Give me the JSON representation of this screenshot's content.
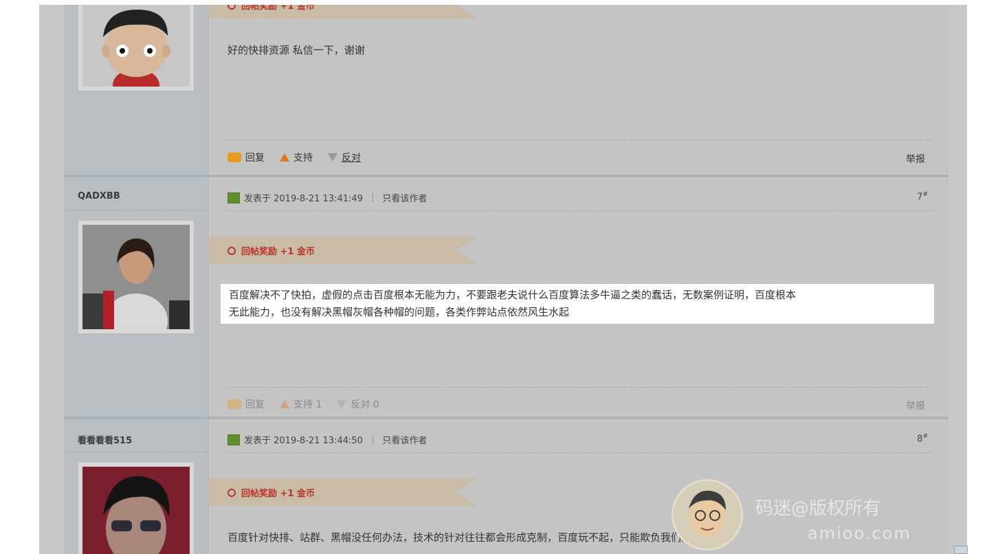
{
  "posts": [
    {
      "author": "",
      "body": "好的快排资源 私信一下，谢谢",
      "reward": "回帖奖励 +1 金币",
      "actions": {
        "reply": "回复",
        "support": "支持",
        "oppose": "反对",
        "report": "举报"
      }
    },
    {
      "author": "QADXBB",
      "meta_prefix": "发表于 2019-8-21 13:41:49",
      "only_author": "只看该作者",
      "floor": "7",
      "floor_mark": "#",
      "reward": "回帖奖励 +1 金币",
      "body_line1": "百度解决不了快拍，虚假的点击百度根本无能为力，不要跟老夫说什么百度算法多牛逼之类的蠢话，无数案例证明，百度根本",
      "body_line2": "无此能力，也没有解决黑帽灰帽各种帽的问题，各类作弊站点依然风生水起",
      "actions": {
        "reply": "回复",
        "support": "支持 1",
        "oppose": "反对 0",
        "report": "举报"
      }
    },
    {
      "author": "看看看看515",
      "meta_prefix": "发表于 2019-8-21 13:44:50",
      "only_author": "只看该作者",
      "floor": "8",
      "floor_mark": "#",
      "reward": "回帖奖励 +1 金币",
      "body": "百度针对快排、站群、黑帽没任何办法，技术的针对往往都会形成克制，百度玩不起，只能欺负我们的老实人。"
    }
  ],
  "watermark": {
    "line1": "码迷@版权所有",
    "line2": "amioo.com"
  }
}
